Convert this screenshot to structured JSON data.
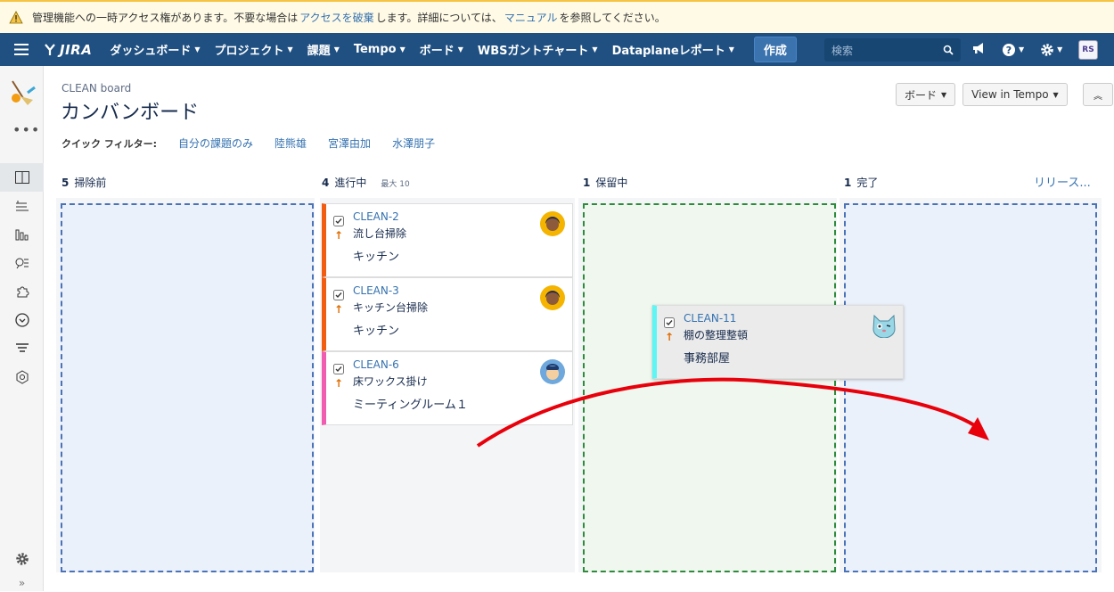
{
  "banner": {
    "text1": "管理機能への一時アクセス権があります。不要な場合は",
    "link1": "アクセスを破棄",
    "text2": "します。詳細については、",
    "link2": "マニュアル",
    "text3": "を参照してください。"
  },
  "nav": {
    "logo": "JIRA",
    "items": [
      "ダッシュボード",
      "プロジェクト",
      "課題",
      "Tempo",
      "ボード",
      "WBSガントチャート",
      "Dataplaneレポート"
    ],
    "create": "作成",
    "search_placeholder": "検索"
  },
  "page": {
    "crumb": "CLEAN board",
    "title": "カンバンボード",
    "qf_label": "クイック フィルター:",
    "filters": [
      "自分の課題のみ",
      "陸熊雄",
      "宮澤由加",
      "水澤朋子"
    ],
    "board_btn": "ボード",
    "tempo_btn": "View in Tempo",
    "release": "リリース..."
  },
  "columns": [
    {
      "count": "5",
      "name": "掃除前",
      "max": ""
    },
    {
      "count": "4",
      "name": "進行中",
      "max": "最大 10"
    },
    {
      "count": "1",
      "name": "保留中",
      "max": ""
    },
    {
      "count": "1",
      "name": "完了",
      "max": ""
    }
  ],
  "cards": [
    {
      "key": "CLEAN-2",
      "summary": "流し台掃除",
      "epic": "キッチン",
      "color": "#f15c10"
    },
    {
      "key": "CLEAN-3",
      "summary": "キッチン台掃除",
      "epic": "キッチン",
      "color": "#f15c10"
    },
    {
      "key": "CLEAN-6",
      "summary": "床ワックス掛け",
      "epic": "ミーティングルーム１",
      "color": "#f15cb0"
    },
    {
      "key": "CLEAN-11",
      "summary": "棚の整理整頓",
      "epic": "事務部屋",
      "color": "#5ef5f5"
    }
  ]
}
